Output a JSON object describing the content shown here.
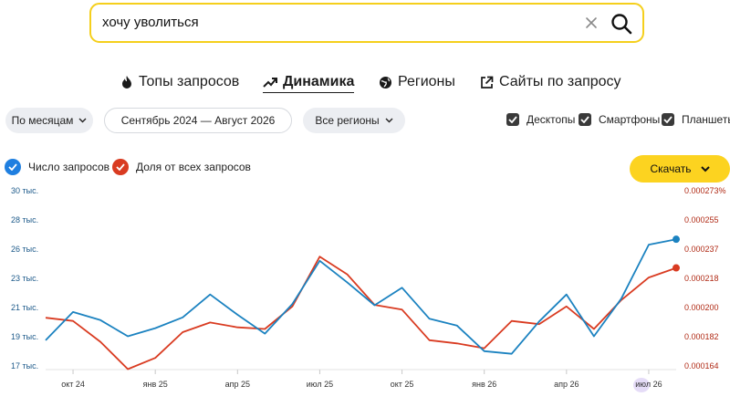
{
  "search": {
    "query": "хочу уволиться"
  },
  "tabs": [
    {
      "label": "Топы запросов",
      "icon": "fire-icon"
    },
    {
      "label": "Динамика",
      "icon": "trend-up-icon",
      "active": true
    },
    {
      "label": "Регионы",
      "icon": "globe-icon"
    },
    {
      "label": "Сайты по запросу",
      "icon": "external-link-icon"
    }
  ],
  "filters": {
    "period_label": "По месяцам",
    "date_range": "Сентябрь 2024 — Август 2026",
    "regions_label": "Все регионы",
    "devices": [
      "Десктопы",
      "Смартфоны",
      "Планшеты"
    ]
  },
  "legend": {
    "series1": "Число запросов",
    "series2": "Доля от всех запросов"
  },
  "download_label": "Скачать",
  "colors": {
    "accent": "#fcd320",
    "series1": "#1b82c0",
    "series2": "#d93b21",
    "legend_blue": "#1f7fe0"
  },
  "chart_data": {
    "type": "line",
    "x_ticks": [
      "окт 24",
      "янв 25",
      "апр 25",
      "июл 25",
      "окт 25",
      "янв 26",
      "апр 26",
      "июл 26"
    ],
    "y_left_ticks": [
      "30 тыс.",
      "28 тыс.",
      "26 тыс.",
      "23 тыс.",
      "21 тыс.",
      "19 тыс.",
      "17 тыс."
    ],
    "y_right_ticks": [
      "0.000273%",
      "0.000255",
      "0.000237",
      "0.000218",
      "0.000200",
      "0.000182",
      "0.000164"
    ],
    "ylim_left": [
      17,
      30
    ],
    "ylim_right": [
      0.000164,
      0.000273
    ],
    "series": [
      {
        "name": "Число запросов",
        "values": [
          18.9,
          21.0,
          20.4,
          19.2,
          19.8,
          20.6,
          22.3,
          20.8,
          19.4,
          21.6,
          24.8,
          23.2,
          21.5,
          22.8,
          20.5,
          20.0,
          18.1,
          17.9,
          20.3,
          22.3,
          19.2,
          22.0,
          26.0,
          26.4
        ]
      },
      {
        "name": "Доля от всех запросов",
        "values": [
          0.000194,
          0.000192,
          0.000179,
          0.000162,
          0.000169,
          0.000185,
          0.000191,
          0.000188,
          0.000187,
          0.000201,
          0.000232,
          0.000221,
          0.000202,
          0.000199,
          0.00018,
          0.000178,
          0.000175,
          0.000192,
          0.00019,
          0.000201,
          0.000187,
          0.000205,
          0.000219,
          0.000225
        ]
      }
    ]
  }
}
